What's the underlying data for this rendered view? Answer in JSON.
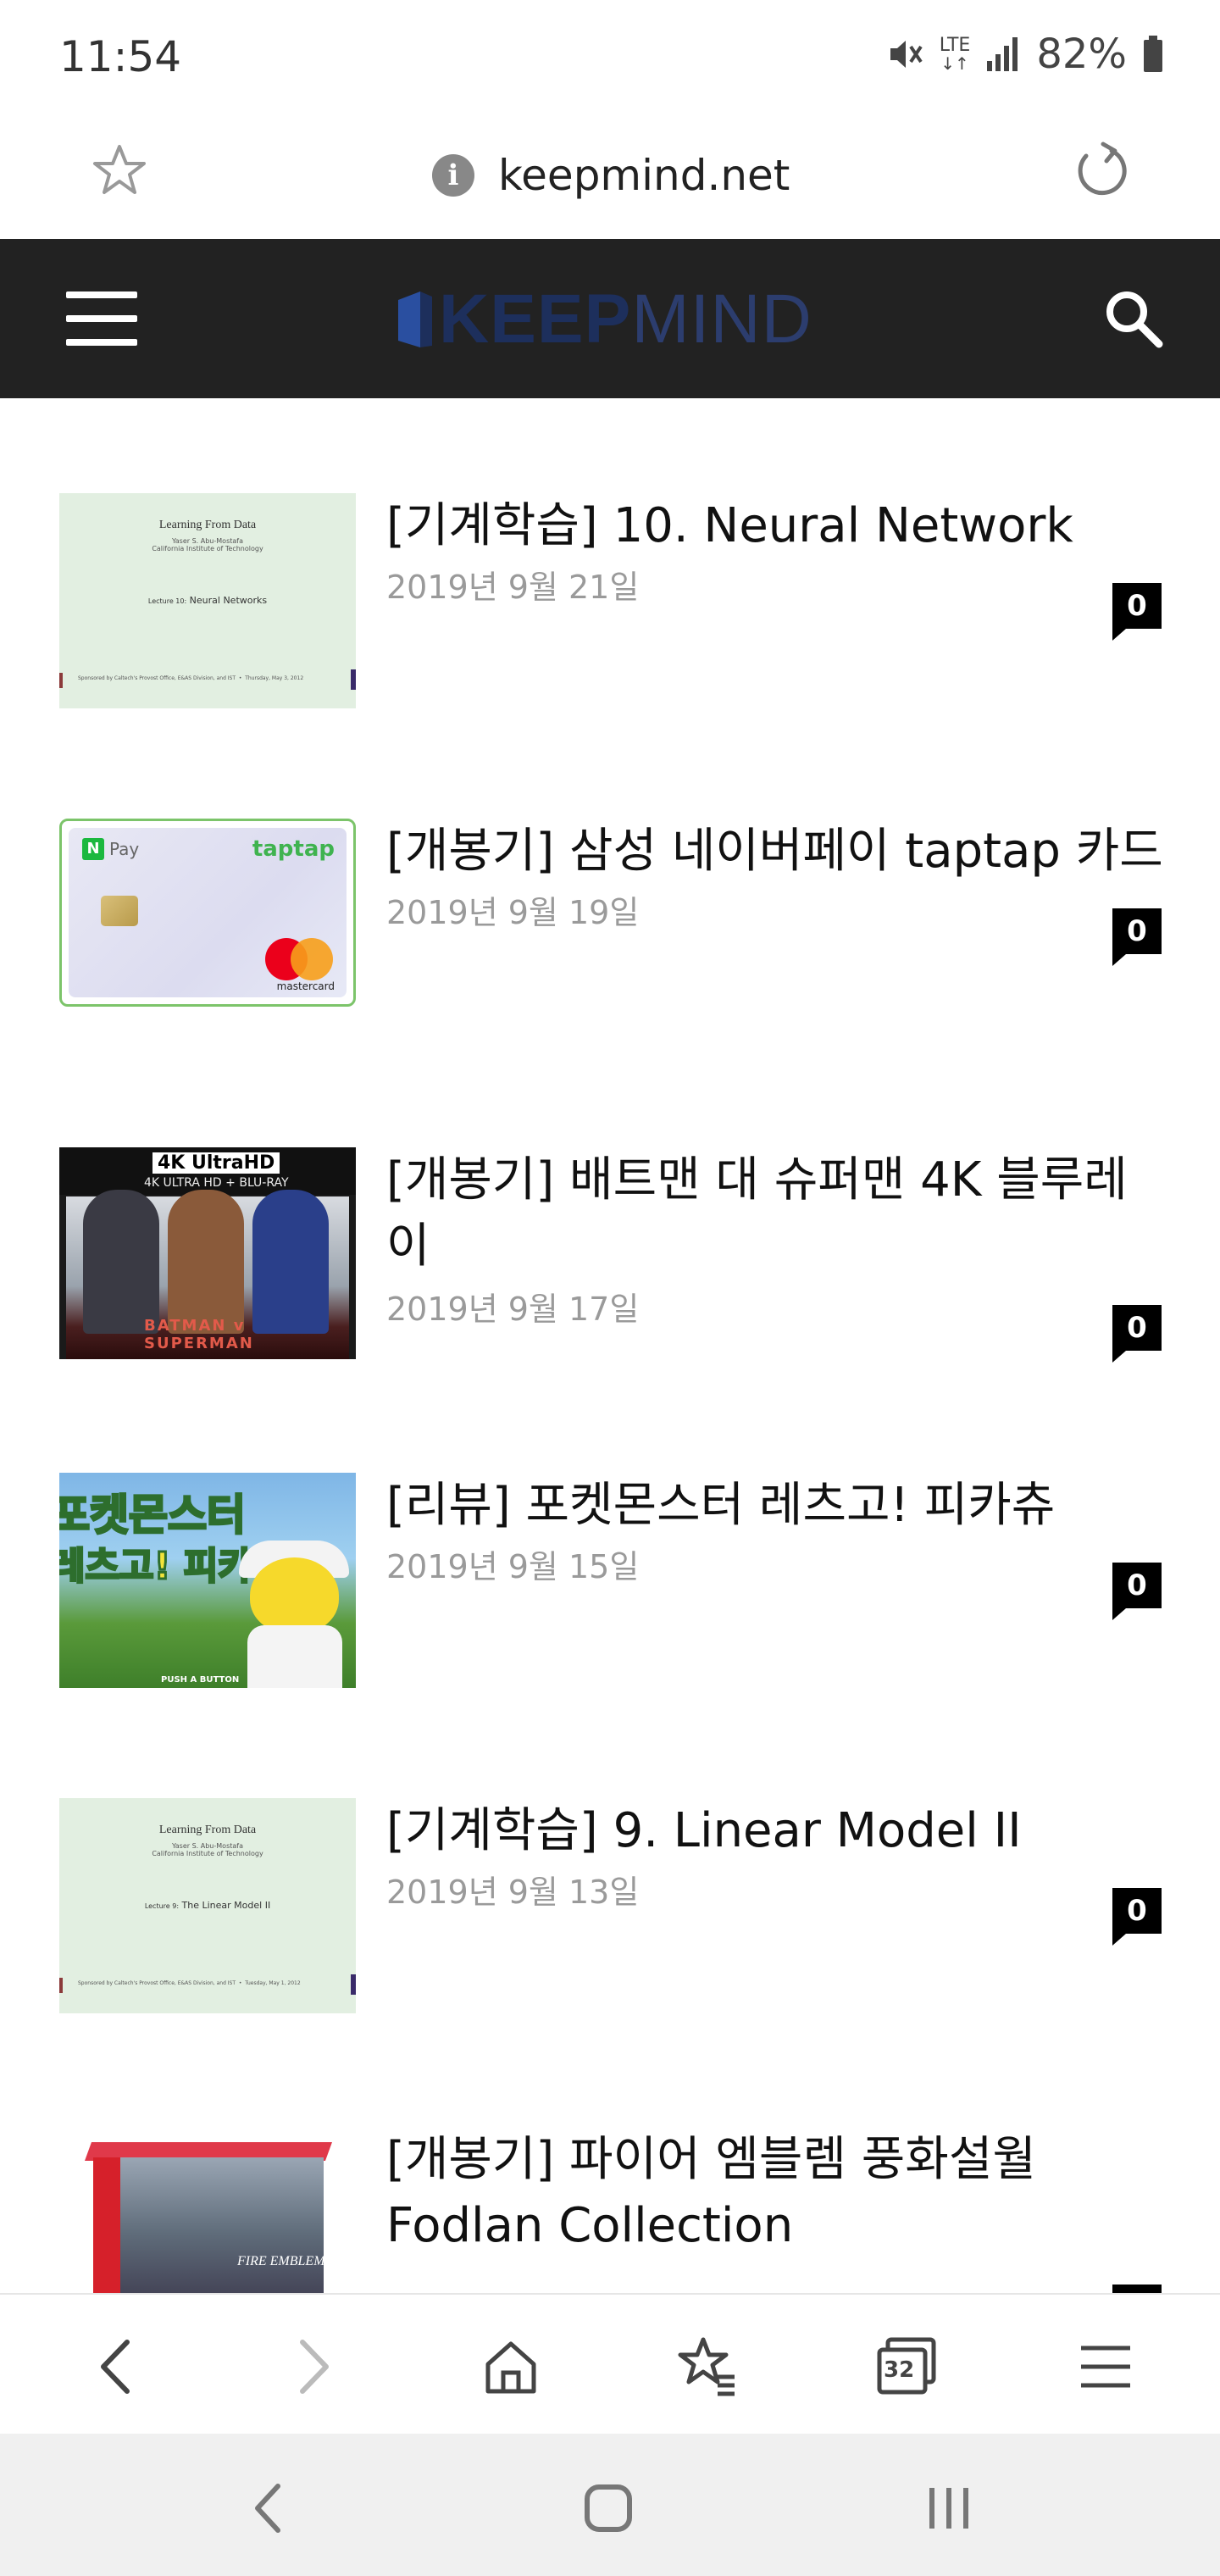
{
  "status_bar": {
    "time": "11:54",
    "network": "LTE",
    "battery": "82%"
  },
  "address_bar": {
    "url": "keepmind.net",
    "info_symbol": "i"
  },
  "site_header": {
    "logo_keep": "KEEP",
    "logo_mind": "MIND",
    "logo_color": "#1d2f5c",
    "background": "#222222"
  },
  "posts": [
    {
      "title": "[기계학습] 10. Neural Network",
      "date": "2019년 9월 21일",
      "comments": "0",
      "thumb": "slide",
      "slide": {
        "heading": "Learning From Data",
        "author": "Yaser S. Abu-Mostafa",
        "inst": "California Institute of Technology",
        "lecture": "Lecture 10:",
        "lecture_title": "Neural Networks",
        "footer": "Sponsored by Caltech's Provost Office, E&AS Division, and IST",
        "footer_date": "Thursday, May 3, 2012"
      }
    },
    {
      "title": "[개봉기] 삼성 네이버페이 taptap 카드",
      "date": "2019년 9월 19일",
      "comments": "0",
      "thumb": "card",
      "card": {
        "npay": "N",
        "pay": "Pay",
        "brand": "taptap",
        "network": "mastercard"
      }
    },
    {
      "title": "[개봉기] 배트맨 대 슈퍼맨 4K 블루레이",
      "date": "2019년 9월 17일",
      "comments": "0",
      "thumb": "bluray",
      "bluray": {
        "badge": "4K UltraHD",
        "format": "4K ULTRA HD + BLU-RAY",
        "movie": "BATMAN v SUPERMAN"
      }
    },
    {
      "title": "[리뷰] 포켓몬스터 레츠고! 피카츄",
      "date": "2019년 9월 15일",
      "comments": "0",
      "thumb": "pika",
      "pika": {
        "line1": "포켓몬스터",
        "line2": "레츠고! 피카츄",
        "tag": "PUSH A BUTTON"
      }
    },
    {
      "title": "[기계학습] 9. Linear Model II",
      "date": "2019년 9월 13일",
      "comments": "0",
      "thumb": "slide",
      "slide": {
        "heading": "Learning From Data",
        "author": "Yaser S. Abu-Mostafa",
        "inst": "California Institute of Technology",
        "lecture": "Lecture 9:",
        "lecture_title": "The Linear Model II",
        "footer": "Sponsored by Caltech's Provost Office, E&AS Division, and IST",
        "footer_date": "Tuesday, May 1, 2012"
      }
    },
    {
      "title": "[개봉기] 파이어 엠블렘 풍화설월 Fodlan Collection",
      "date": "",
      "comments": "",
      "thumb": "nsw",
      "nsw": {
        "game": "FIRE EMBLEM"
      }
    }
  ],
  "browser_toolbar": {
    "tabs_count": "32"
  }
}
